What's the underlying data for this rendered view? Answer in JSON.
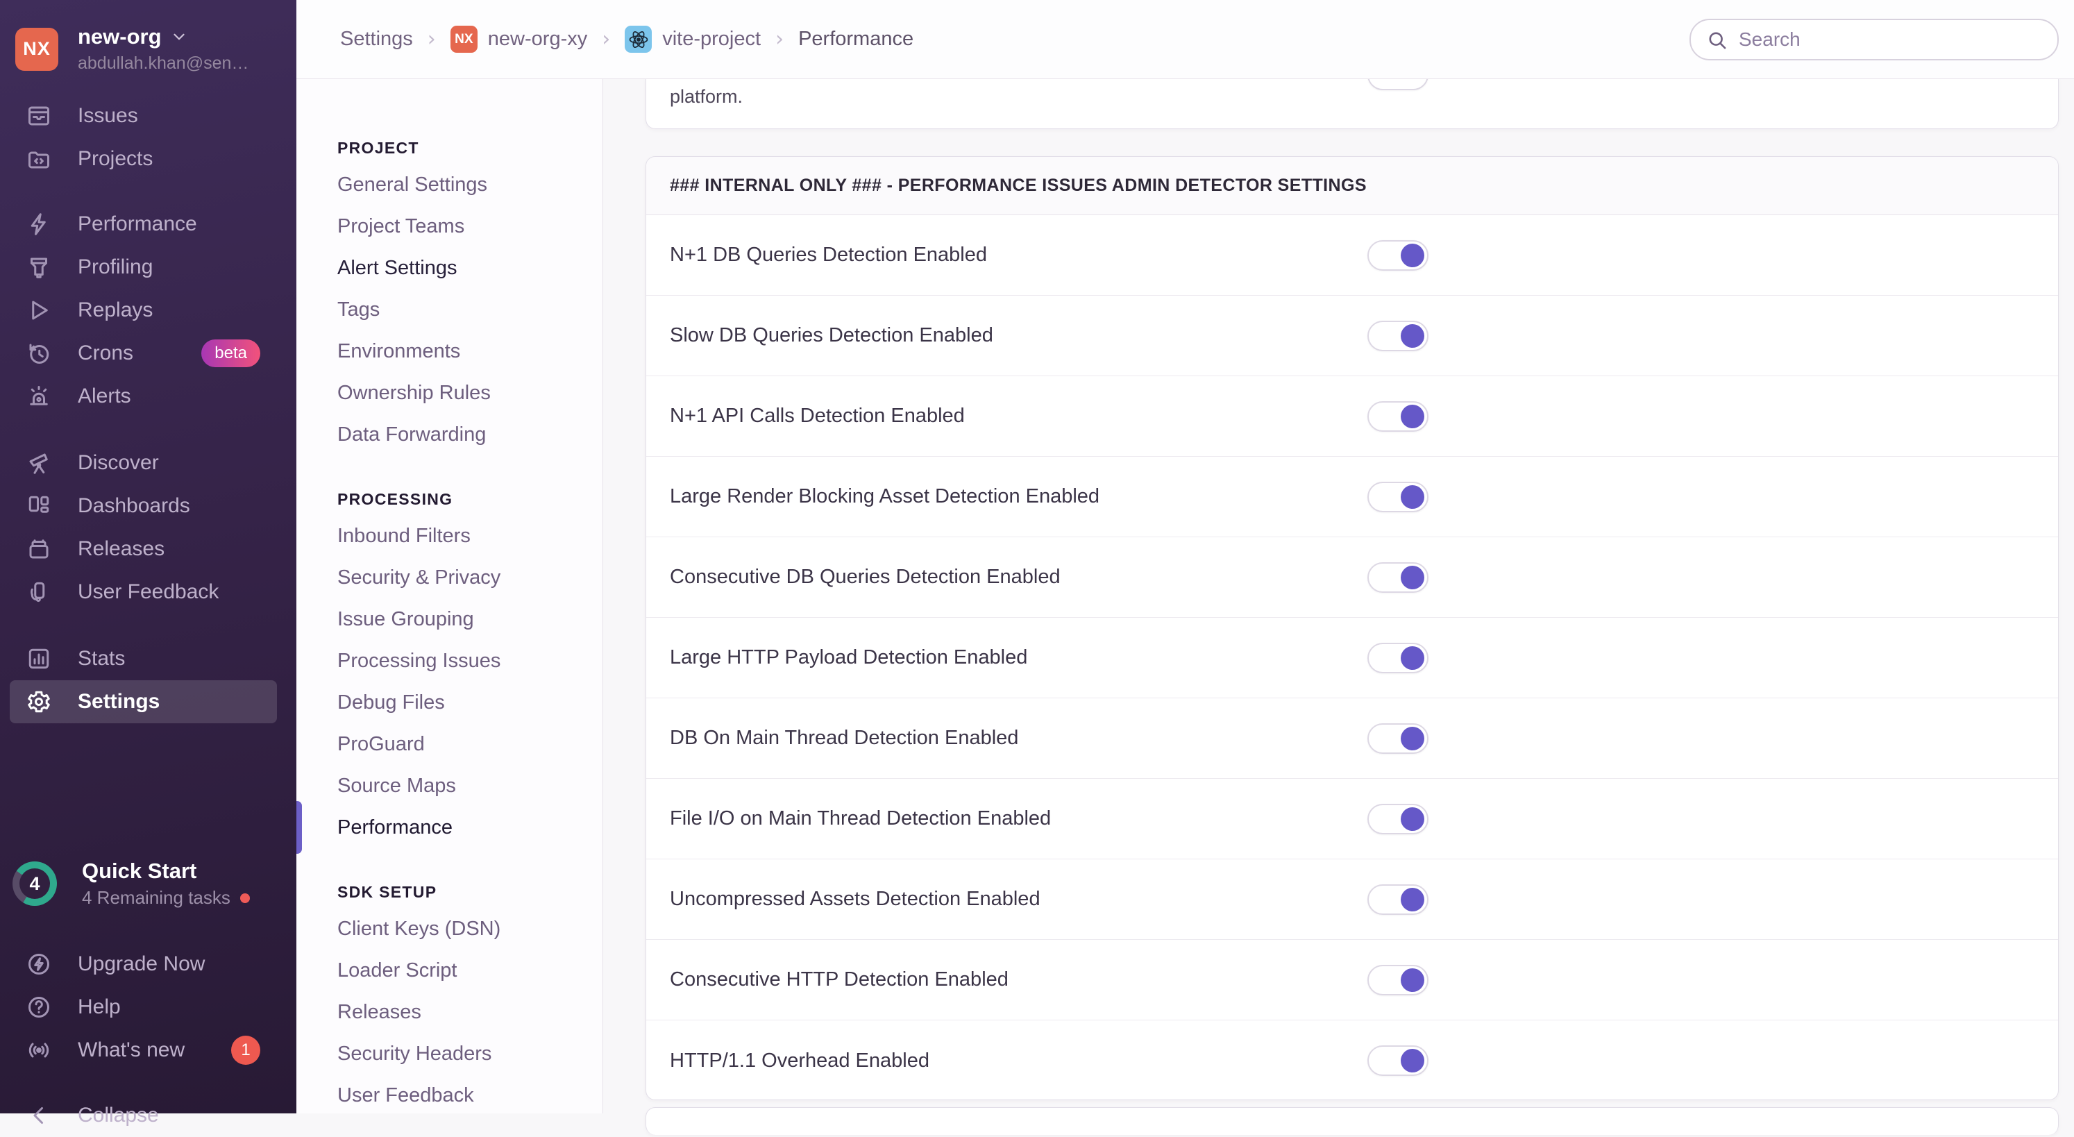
{
  "sidebar": {
    "org": {
      "initials": "NX",
      "name": "new-org",
      "email": "abdullah.khan@sen…"
    },
    "nav_groups": [
      [
        {
          "label": "Issues",
          "icon": "issues-icon"
        },
        {
          "label": "Projects",
          "icon": "projects-icon"
        }
      ],
      [
        {
          "label": "Performance",
          "icon": "performance-icon"
        },
        {
          "label": "Profiling",
          "icon": "profiling-icon"
        },
        {
          "label": "Replays",
          "icon": "replays-icon"
        },
        {
          "label": "Crons",
          "icon": "crons-icon",
          "badge": "beta"
        },
        {
          "label": "Alerts",
          "icon": "alerts-icon"
        }
      ],
      [
        {
          "label": "Discover",
          "icon": "discover-icon"
        },
        {
          "label": "Dashboards",
          "icon": "dashboards-icon"
        },
        {
          "label": "Releases",
          "icon": "releases-icon"
        },
        {
          "label": "User Feedback",
          "icon": "user-feedback-icon"
        }
      ],
      [
        {
          "label": "Stats",
          "icon": "stats-icon"
        },
        {
          "label": "Settings",
          "icon": "settings-icon",
          "active": true
        }
      ]
    ],
    "quick_start": {
      "title": "Quick Start",
      "subtitle": "4 Remaining tasks",
      "count": "4"
    },
    "footer": [
      {
        "label": "Upgrade Now",
        "icon": "upgrade-icon"
      },
      {
        "label": "Help",
        "icon": "help-icon"
      },
      {
        "label": "What's new",
        "icon": "whats-new-icon",
        "badge": "1"
      }
    ],
    "collapse": {
      "label": "Collapse",
      "icon": "collapse-icon"
    }
  },
  "breadcrumb": {
    "items": [
      "Settings",
      "new-org-xy",
      "vite-project",
      "Performance"
    ],
    "org_initials": "NX"
  },
  "search": {
    "placeholder": "Search"
  },
  "subnav": {
    "sections": [
      {
        "title": "PROJECT",
        "items": [
          {
            "label": "General Settings"
          },
          {
            "label": "Project Teams"
          },
          {
            "label": "Alert Settings",
            "emphasis": true
          },
          {
            "label": "Tags"
          },
          {
            "label": "Environments"
          },
          {
            "label": "Ownership Rules"
          },
          {
            "label": "Data Forwarding"
          }
        ]
      },
      {
        "title": "PROCESSING",
        "items": [
          {
            "label": "Inbound Filters"
          },
          {
            "label": "Security & Privacy"
          },
          {
            "label": "Issue Grouping"
          },
          {
            "label": "Processing Issues"
          },
          {
            "label": "Debug Files"
          },
          {
            "label": "ProGuard"
          },
          {
            "label": "Source Maps"
          },
          {
            "label": "Performance",
            "active": true
          }
        ]
      },
      {
        "title": "SDK SETUP",
        "items": [
          {
            "label": "Client Keys (DSN)"
          },
          {
            "label": "Loader Script"
          },
          {
            "label": "Releases"
          },
          {
            "label": "Security Headers"
          },
          {
            "label": "User Feedback"
          }
        ]
      }
    ]
  },
  "content": {
    "partial_top_text": "platform.",
    "panel": {
      "title": "### INTERNAL ONLY ### - PERFORMANCE ISSUES ADMIN DETECTOR SETTINGS",
      "settings": [
        {
          "label": "N+1 DB Queries Detection Enabled",
          "enabled": true
        },
        {
          "label": "Slow DB Queries Detection Enabled",
          "enabled": true
        },
        {
          "label": "N+1 API Calls Detection Enabled",
          "enabled": true
        },
        {
          "label": "Large Render Blocking Asset Detection Enabled",
          "enabled": true
        },
        {
          "label": "Consecutive DB Queries Detection Enabled",
          "enabled": true
        },
        {
          "label": "Large HTTP Payload Detection Enabled",
          "enabled": true
        },
        {
          "label": "DB On Main Thread Detection Enabled",
          "enabled": true
        },
        {
          "label": "File I/O on Main Thread Detection Enabled",
          "enabled": true
        },
        {
          "label": "Uncompressed Assets Detection Enabled",
          "enabled": true
        },
        {
          "label": "Consecutive HTTP Detection Enabled",
          "enabled": true
        },
        {
          "label": "HTTP/1.1 Overhead Enabled",
          "enabled": true
        }
      ]
    }
  },
  "colors": {
    "accent": "#6C5FC7",
    "toggle_on": "#6558C8",
    "org_avatar": "#E5674E",
    "project_icon_bg": "#7cc5ec",
    "beta_badge_gradient": [
      "#a737b4",
      "#f2527b"
    ],
    "alert_badge": "#ee5950",
    "progress_green": "#2fa98d"
  }
}
